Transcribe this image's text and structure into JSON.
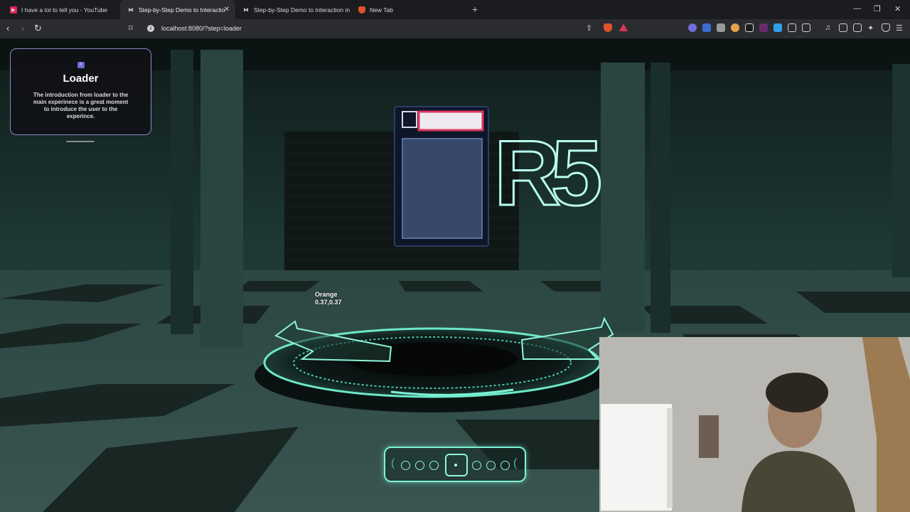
{
  "browser": {
    "tabs": [
      {
        "title": "I have a lot to tell you - YouTube",
        "active": false,
        "favicon": "youtube-icon"
      },
      {
        "title": "Step-by-Step Demo to Interactio",
        "active": true,
        "favicon": "app-icon"
      },
      {
        "title": "Step-by-Step Demo to Interaction in",
        "active": false,
        "favicon": "app-icon"
      },
      {
        "title": "New Tab",
        "active": false,
        "favicon": "brave-icon"
      }
    ],
    "url": "localhost:8080/?step=loader"
  },
  "card": {
    "badge": "3",
    "title": "Loader",
    "description": "The introduction from loader to the main experinece is a great moment to introduce the user to the experince."
  },
  "scene": {
    "logo_text": "R5",
    "label_name": "Orange",
    "label_coords": "0.37,0.37"
  },
  "stepper": {
    "total_steps": 7,
    "current_step": 4
  },
  "colors": {
    "accent": "#7ff2d6",
    "card_border": "#8b88c9",
    "badge": "#6d6bd6"
  }
}
